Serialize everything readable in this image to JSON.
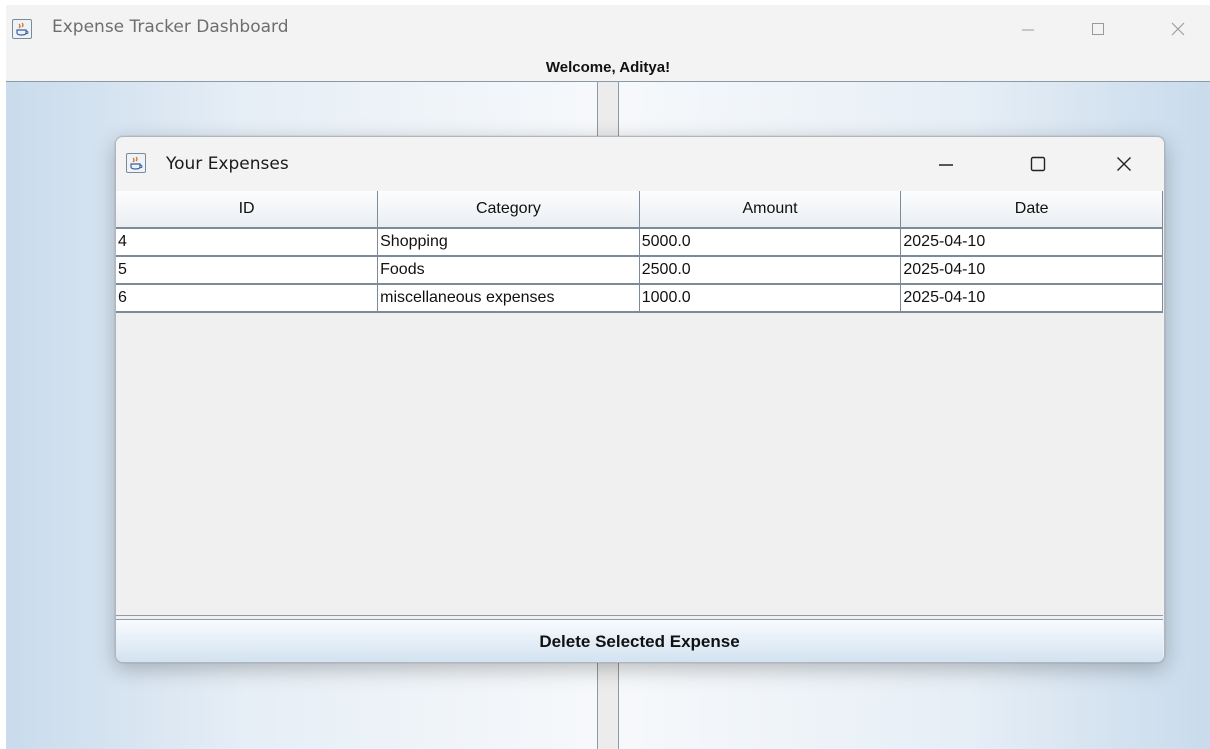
{
  "main_window": {
    "title": "Expense Tracker Dashboard",
    "welcome": "Welcome, Aditya!"
  },
  "expenses_window": {
    "title": "Your Expenses",
    "columns": [
      "ID",
      "Category",
      "Amount",
      "Date"
    ],
    "rows": [
      [
        "4",
        "Shopping",
        "5000.0",
        "2025-04-10"
      ],
      [
        "5",
        "Foods",
        "2500.0",
        "2025-04-10"
      ],
      [
        "6",
        "miscellaneous expenses",
        "1000.0",
        "2025-04-10"
      ]
    ],
    "delete_label": "Delete Selected Expense"
  },
  "icons": {
    "app": "java-cup-icon",
    "minimize": "minimize-icon",
    "maximize": "maximize-icon",
    "close": "close-icon"
  }
}
